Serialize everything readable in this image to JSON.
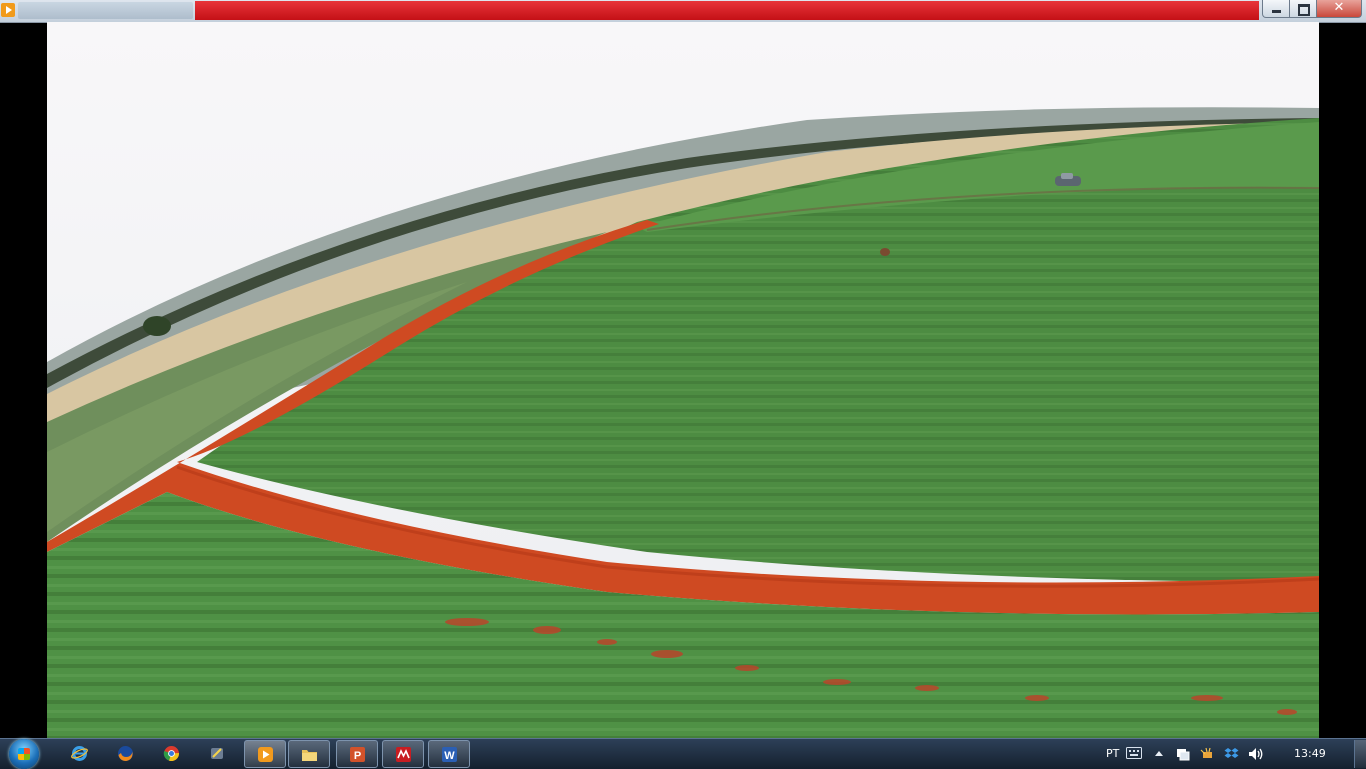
{
  "window": {
    "title": "",
    "buttons": {
      "close_label": "✕"
    }
  },
  "taskbar": {
    "start_icon": "windows-orb-icon",
    "pinned": [
      {
        "name": "internet-explorer-icon"
      },
      {
        "name": "firefox-icon"
      },
      {
        "name": "chrome-icon"
      },
      {
        "name": "app-icon"
      }
    ],
    "open_apps": [
      {
        "name": "media-player-icon",
        "label": "",
        "active": true
      },
      {
        "name": "file-explorer-icon",
        "label": "",
        "active": false
      },
      {
        "name": "powerpoint-icon",
        "label": "P",
        "active": false
      },
      {
        "name": "pdf-editor-icon",
        "label": "",
        "active": false
      },
      {
        "name": "word-icon",
        "label": "W",
        "active": false
      }
    ],
    "tray": {
      "language": "PT",
      "clock": "13:49",
      "icons": [
        "keyboard-icon",
        "show-hidden-icons-icon",
        "network-icon",
        "power-icon",
        "dropbox-icon",
        "volume-icon"
      ]
    }
  },
  "colors": {
    "title_strip": "#d31a1f",
    "crop_green": "#4f8f45",
    "soil_red": "#d2441f",
    "sky": "#f3f3f5"
  }
}
